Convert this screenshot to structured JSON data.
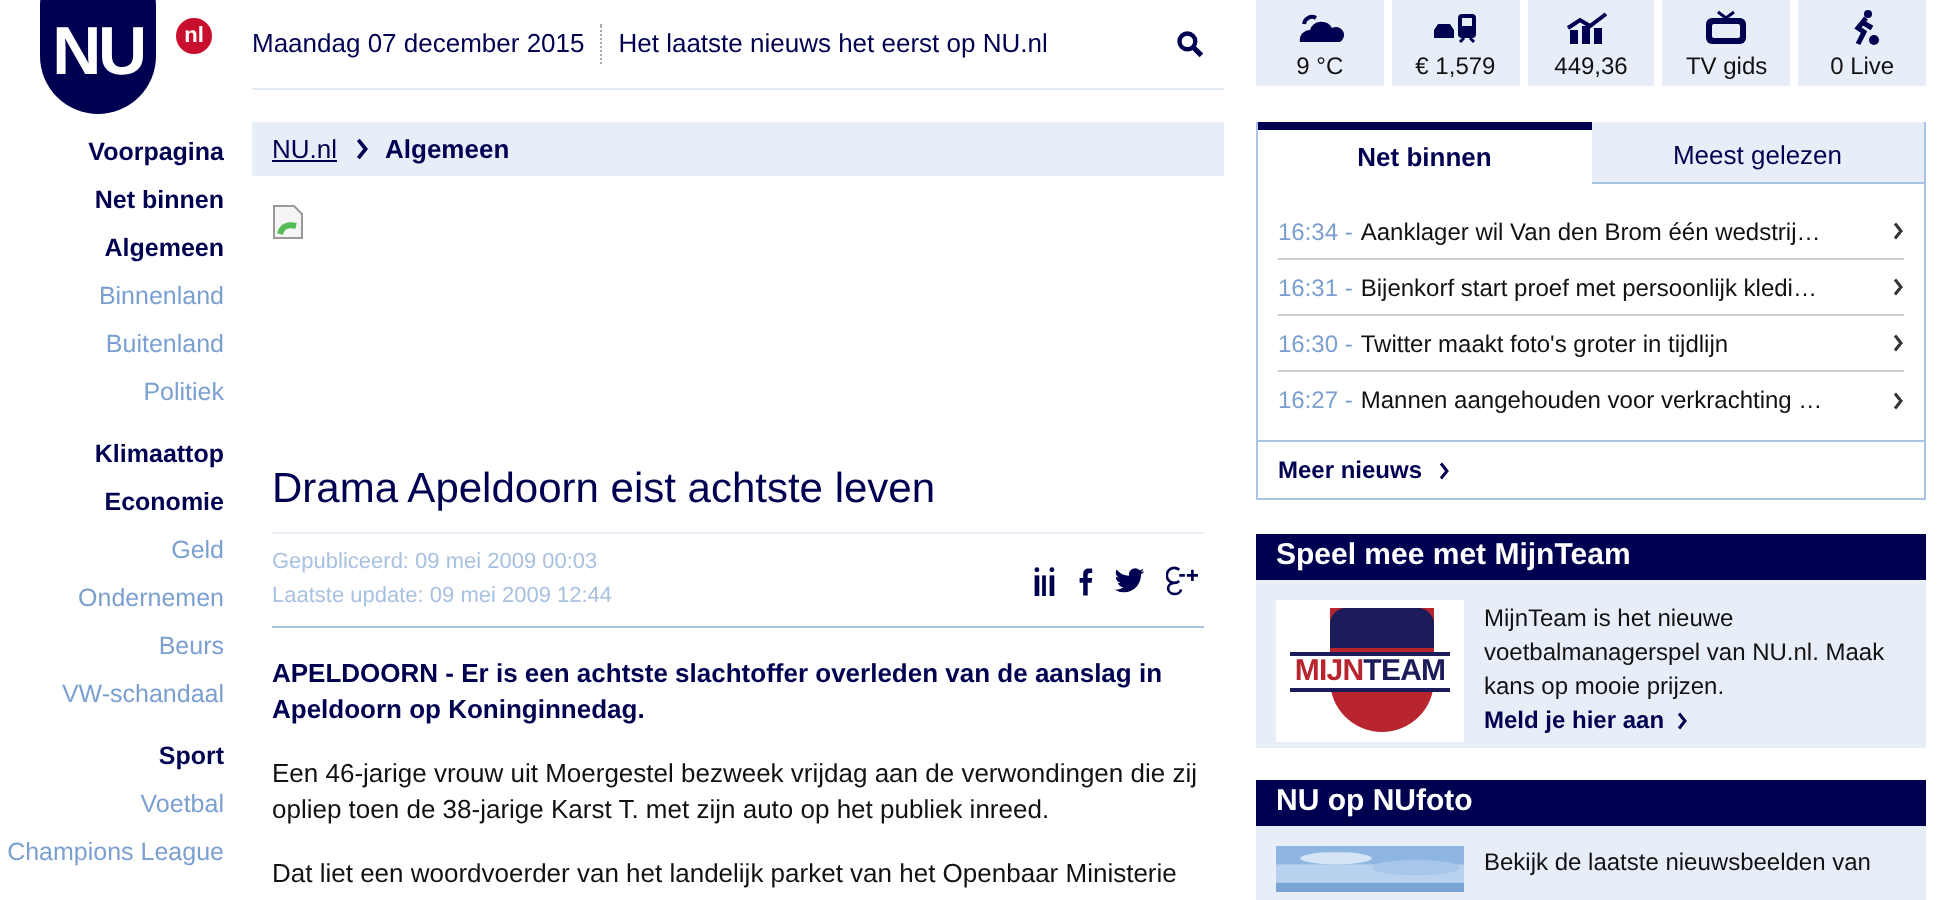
{
  "logo": {
    "text": "NU",
    "badge": "nl"
  },
  "header": {
    "date": "Maandag 07 december 2015",
    "tagline": "Het laatste nieuws het eerst op NU.nl"
  },
  "nav": {
    "groups": [
      {
        "items": [
          {
            "label": "Voorpagina",
            "kind": "section"
          },
          {
            "label": "Net binnen",
            "kind": "section"
          },
          {
            "label": "Algemeen",
            "kind": "section"
          },
          {
            "label": "Binnenland",
            "kind": "sub"
          },
          {
            "label": "Buitenland",
            "kind": "sub"
          },
          {
            "label": "Politiek",
            "kind": "sub"
          }
        ]
      },
      {
        "items": [
          {
            "label": "Klimaattop",
            "kind": "section"
          },
          {
            "label": "Economie",
            "kind": "section"
          },
          {
            "label": "Geld",
            "kind": "sub"
          },
          {
            "label": "Ondernemen",
            "kind": "sub"
          },
          {
            "label": "Beurs",
            "kind": "sub"
          },
          {
            "label": "VW-schandaal",
            "kind": "sub"
          }
        ]
      },
      {
        "items": [
          {
            "label": "Sport",
            "kind": "section"
          },
          {
            "label": "Voetbal",
            "kind": "sub"
          },
          {
            "label": "Champions League",
            "kind": "sub"
          }
        ]
      }
    ]
  },
  "breadcrumb": {
    "home": "NU.nl",
    "current": "Algemeen"
  },
  "article": {
    "title": "Drama Apeldoorn eist achtste leven",
    "published": "Gepubliceerd: 09 mei 2009 00:03",
    "updated": "Laatste update: 09 mei 2009 12:44",
    "lead": "APELDOORN - Er is een achtste slachtoffer overleden van de aanslag in Apeldoorn op Koninginnedag.",
    "paragraphs": [
      "Een 46-jarige vrouw uit Moergestel bezweek vrijdag aan de verwondingen die zij opliep toen de 38-jarige Karst T. met zijn auto op het publiek inreed.",
      "Dat liet een woordvoerder van het landelijk parket van het Openbaar Ministerie"
    ]
  },
  "tiles": [
    {
      "kind": "weather",
      "label": "9 °C"
    },
    {
      "kind": "traffic",
      "label": "€ 1,579"
    },
    {
      "kind": "stocks",
      "label": "449,36"
    },
    {
      "kind": "tv",
      "label": "TV gids"
    },
    {
      "kind": "live",
      "label": "0 Live"
    }
  ],
  "news_tabs": [
    {
      "label": "Net binnen",
      "selected": true
    },
    {
      "label": "Meest gelezen",
      "selected": false
    }
  ],
  "news": [
    {
      "time": "16:34 -",
      "title": "Aanklager wil Van den Brom één wedstrij…"
    },
    {
      "time": "16:31 -",
      "title": "Bijenkorf start proef met persoonlijk kledi…"
    },
    {
      "time": "16:30 -",
      "title": "Twitter maakt foto's groter in tijdlijn"
    },
    {
      "time": "16:27 -",
      "title": "Mannen aangehouden voor verkrachting …"
    }
  ],
  "more_news": "Meer nieuws",
  "mijnteam": {
    "heading": "Speel mee met MijnTeam",
    "logo_part_1": "MIJN",
    "logo_part_2": "TEAM",
    "text": "MijnTeam is het nieuwe voetbalmanagerspel van NU.nl. Maak kans op mooie prijzen.",
    "link": "Meld je hier aan"
  },
  "nufoto": {
    "heading": "NU op NUfoto",
    "text": "Bekijk de laatste nieuwsbeelden van"
  }
}
